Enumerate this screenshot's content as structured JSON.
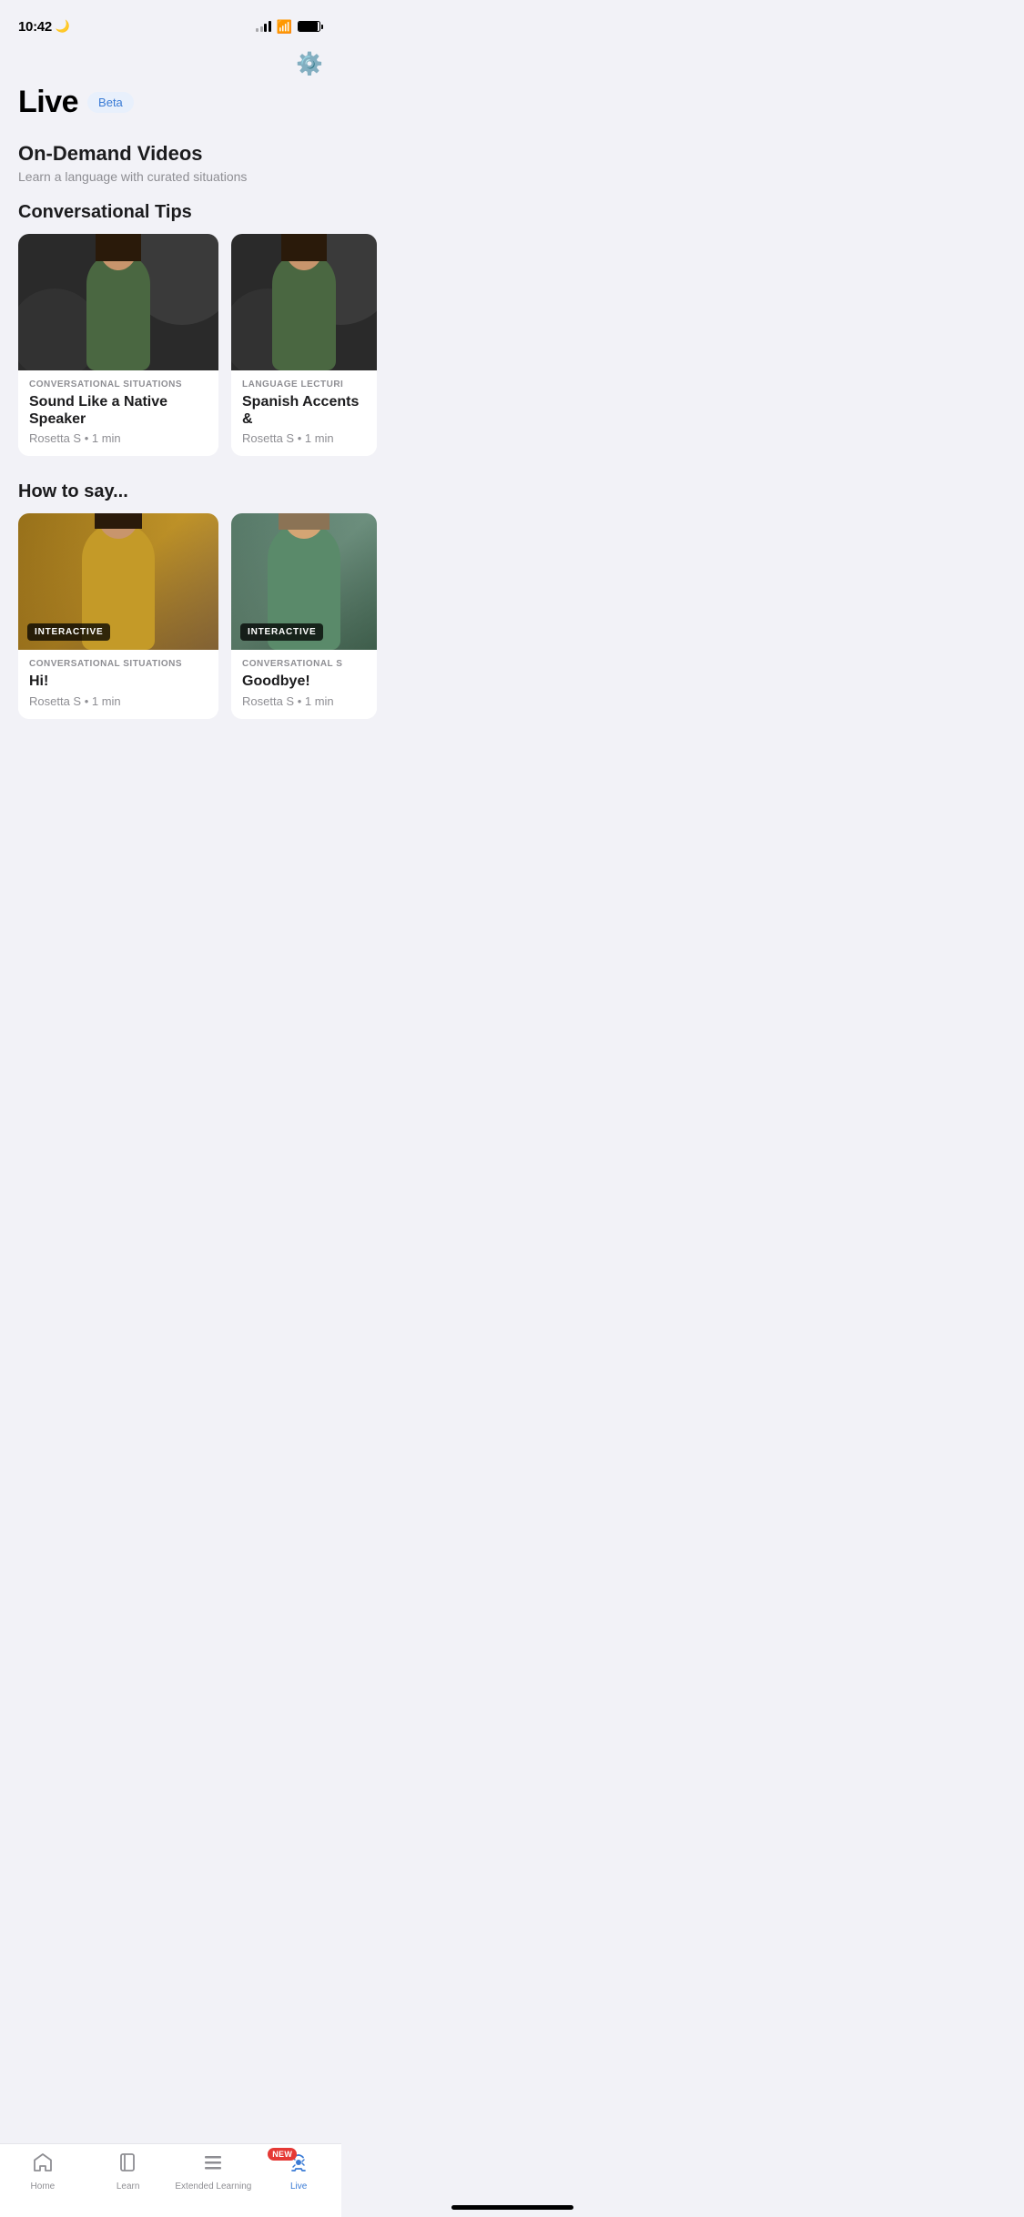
{
  "statusBar": {
    "time": "10:42",
    "moonIcon": "🌙"
  },
  "settings": {
    "icon": "⚙️"
  },
  "header": {
    "title": "Live",
    "betaLabel": "Beta"
  },
  "onDemand": {
    "title": "On-Demand Videos",
    "subtitle": "Learn a language with curated situations"
  },
  "conversationalTips": {
    "sectionTitle": "Conversational Tips",
    "cards": [
      {
        "category": "CONVERSATIONAL SITUATIONS",
        "title": "Sound Like a Native Speaker",
        "author": "Rosetta S",
        "duration": "1 min",
        "badgeLabel": null
      },
      {
        "category": "LANGUAGE LECTURES",
        "title": "Spanish Accents &",
        "author": "Rosetta S",
        "duration": "1 min",
        "badgeLabel": null
      }
    ]
  },
  "howToSay": {
    "sectionTitle": "How to say...",
    "cards": [
      {
        "category": "CONVERSATIONAL SITUATIONS",
        "title": "Hi!",
        "author": "Rosetta S",
        "duration": "1 min",
        "badgeLabel": "INTERACTIVE"
      },
      {
        "category": "CONVERSATIONAL S",
        "title": "Goodbye!",
        "author": "Rosetta S",
        "duration": "1 min",
        "badgeLabel": "INTERACTIVE"
      }
    ]
  },
  "bottomNav": {
    "items": [
      {
        "label": "Home",
        "icon": "home",
        "active": false
      },
      {
        "label": "Learn",
        "icon": "book",
        "active": false
      },
      {
        "label": "Extended Learning",
        "icon": "bars",
        "active": false
      },
      {
        "label": "Live",
        "icon": "headset",
        "active": true,
        "badge": "NEW"
      }
    ]
  }
}
